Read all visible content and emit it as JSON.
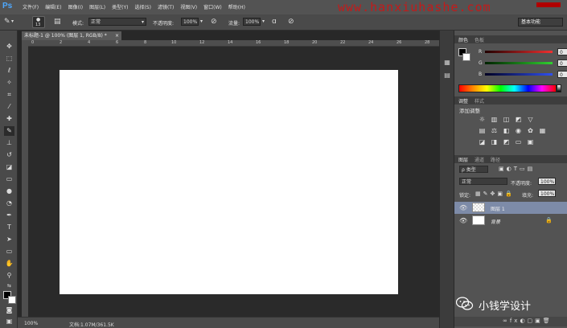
{
  "app": {
    "logo": "Ps"
  },
  "menu": [
    "文件(F)",
    "编辑(E)",
    "图像(I)",
    "图层(L)",
    "类型(Y)",
    "选择(S)",
    "滤镜(T)",
    "视图(V)",
    "窗口(W)",
    "帮助(H)"
  ],
  "watermark": "www.hanxiuhashe.com",
  "options_bar": {
    "brush_size": "13",
    "mode_label": "模式:",
    "mode_value": "正常",
    "opacity_label": "不透明度:",
    "opacity_value": "100%",
    "flow_label": "流量:",
    "flow_value": "100%",
    "workspace": "基本功能"
  },
  "document": {
    "tab_label": "未标题-1 @ 100% (图层 1, RGB/8) *",
    "ruler_ticks": [
      "0",
      "2",
      "4",
      "6",
      "8",
      "10",
      "12",
      "14",
      "16",
      "18",
      "20",
      "22",
      "24",
      "26",
      "28"
    ],
    "canvas_color": "#ffffff"
  },
  "status": {
    "zoom": "100%",
    "doc_size": "文档:1.07M/361.5K"
  },
  "color_panel": {
    "tabs": [
      "颜色",
      "色板"
    ],
    "sliders": [
      {
        "label": "R",
        "value": "0",
        "color": "#d9302a"
      },
      {
        "label": "G",
        "value": "0",
        "color": "#2fb52f"
      },
      {
        "label": "B",
        "value": "0",
        "color": "#2a44d9"
      }
    ],
    "foreground": "#000000",
    "background": "#ffffff"
  },
  "adjustments_panel": {
    "tabs": [
      "调整",
      "样式"
    ],
    "title": "添加调整"
  },
  "layers_panel": {
    "tabs": [
      "图层",
      "通道",
      "路径"
    ],
    "filter_kind": "ρ 类型",
    "blend_mode": "正常",
    "opacity_label": "不透明度:",
    "opacity_value": "100%",
    "lock_label": "锁定:",
    "fill_label": "填充:",
    "fill_value": "100%",
    "layers": [
      {
        "name": "图层 1",
        "selected": true,
        "locked": false
      },
      {
        "name": "背景",
        "selected": false,
        "locked": true
      }
    ]
  },
  "wechat_badge": "小钱学设计"
}
